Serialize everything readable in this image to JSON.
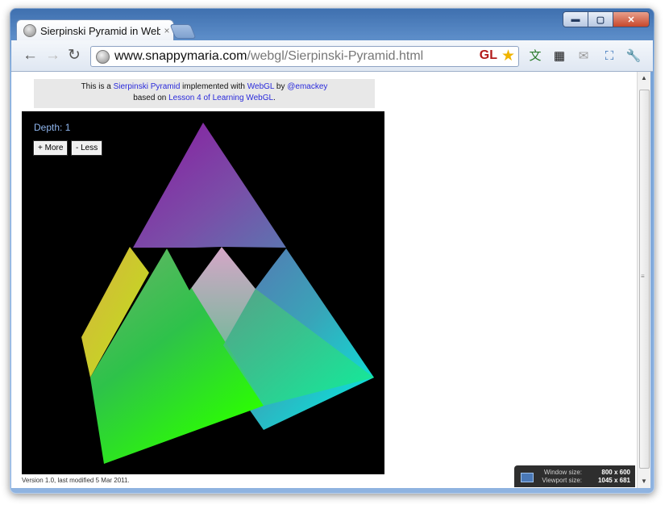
{
  "window": {
    "buttons": {
      "minimize": "▬",
      "maximize": "▢",
      "close": "✕"
    }
  },
  "tab": {
    "title": "Sierpinski Pyramid in WebGL",
    "close": "×"
  },
  "toolbar": {
    "back": "←",
    "forward": "→",
    "reload": "↻",
    "url_host": "www.snappymaria.com",
    "url_path": "/webgl/Sierpinski-Pyramid.html",
    "gl_badge": "GL",
    "star": "★"
  },
  "extensions": {
    "translate": "文",
    "qr": "▦",
    "mail": "✉",
    "fullscreen": "⛶",
    "wrench": "🔧"
  },
  "page": {
    "intro_pre": "This is a ",
    "intro_link1": "Sierpinski Pyramid",
    "intro_mid1": " implemented with ",
    "intro_link2": "WebGL",
    "intro_mid2": " by ",
    "intro_link3": "@emackey",
    "based_pre": "based on ",
    "based_link": "Lesson 4 of Learning WebGL",
    "based_post": ".",
    "depth_label": "Depth: 1",
    "more_button": "+ More",
    "less_button": "- Less",
    "version": "Version 1.0, last modified 5 Mar 2011."
  },
  "size_overlay": {
    "window_label": "Window size:",
    "window_value": "800 x 600",
    "viewport_label": "Viewport size:",
    "viewport_value": "1045 x 681"
  },
  "scrollbar": {
    "up": "▲",
    "down": "▼",
    "grip": "≡"
  },
  "colors": {
    "link": "#2a2adb",
    "depth_text": "#8fb6ef",
    "canvas_bg": "#000000"
  }
}
